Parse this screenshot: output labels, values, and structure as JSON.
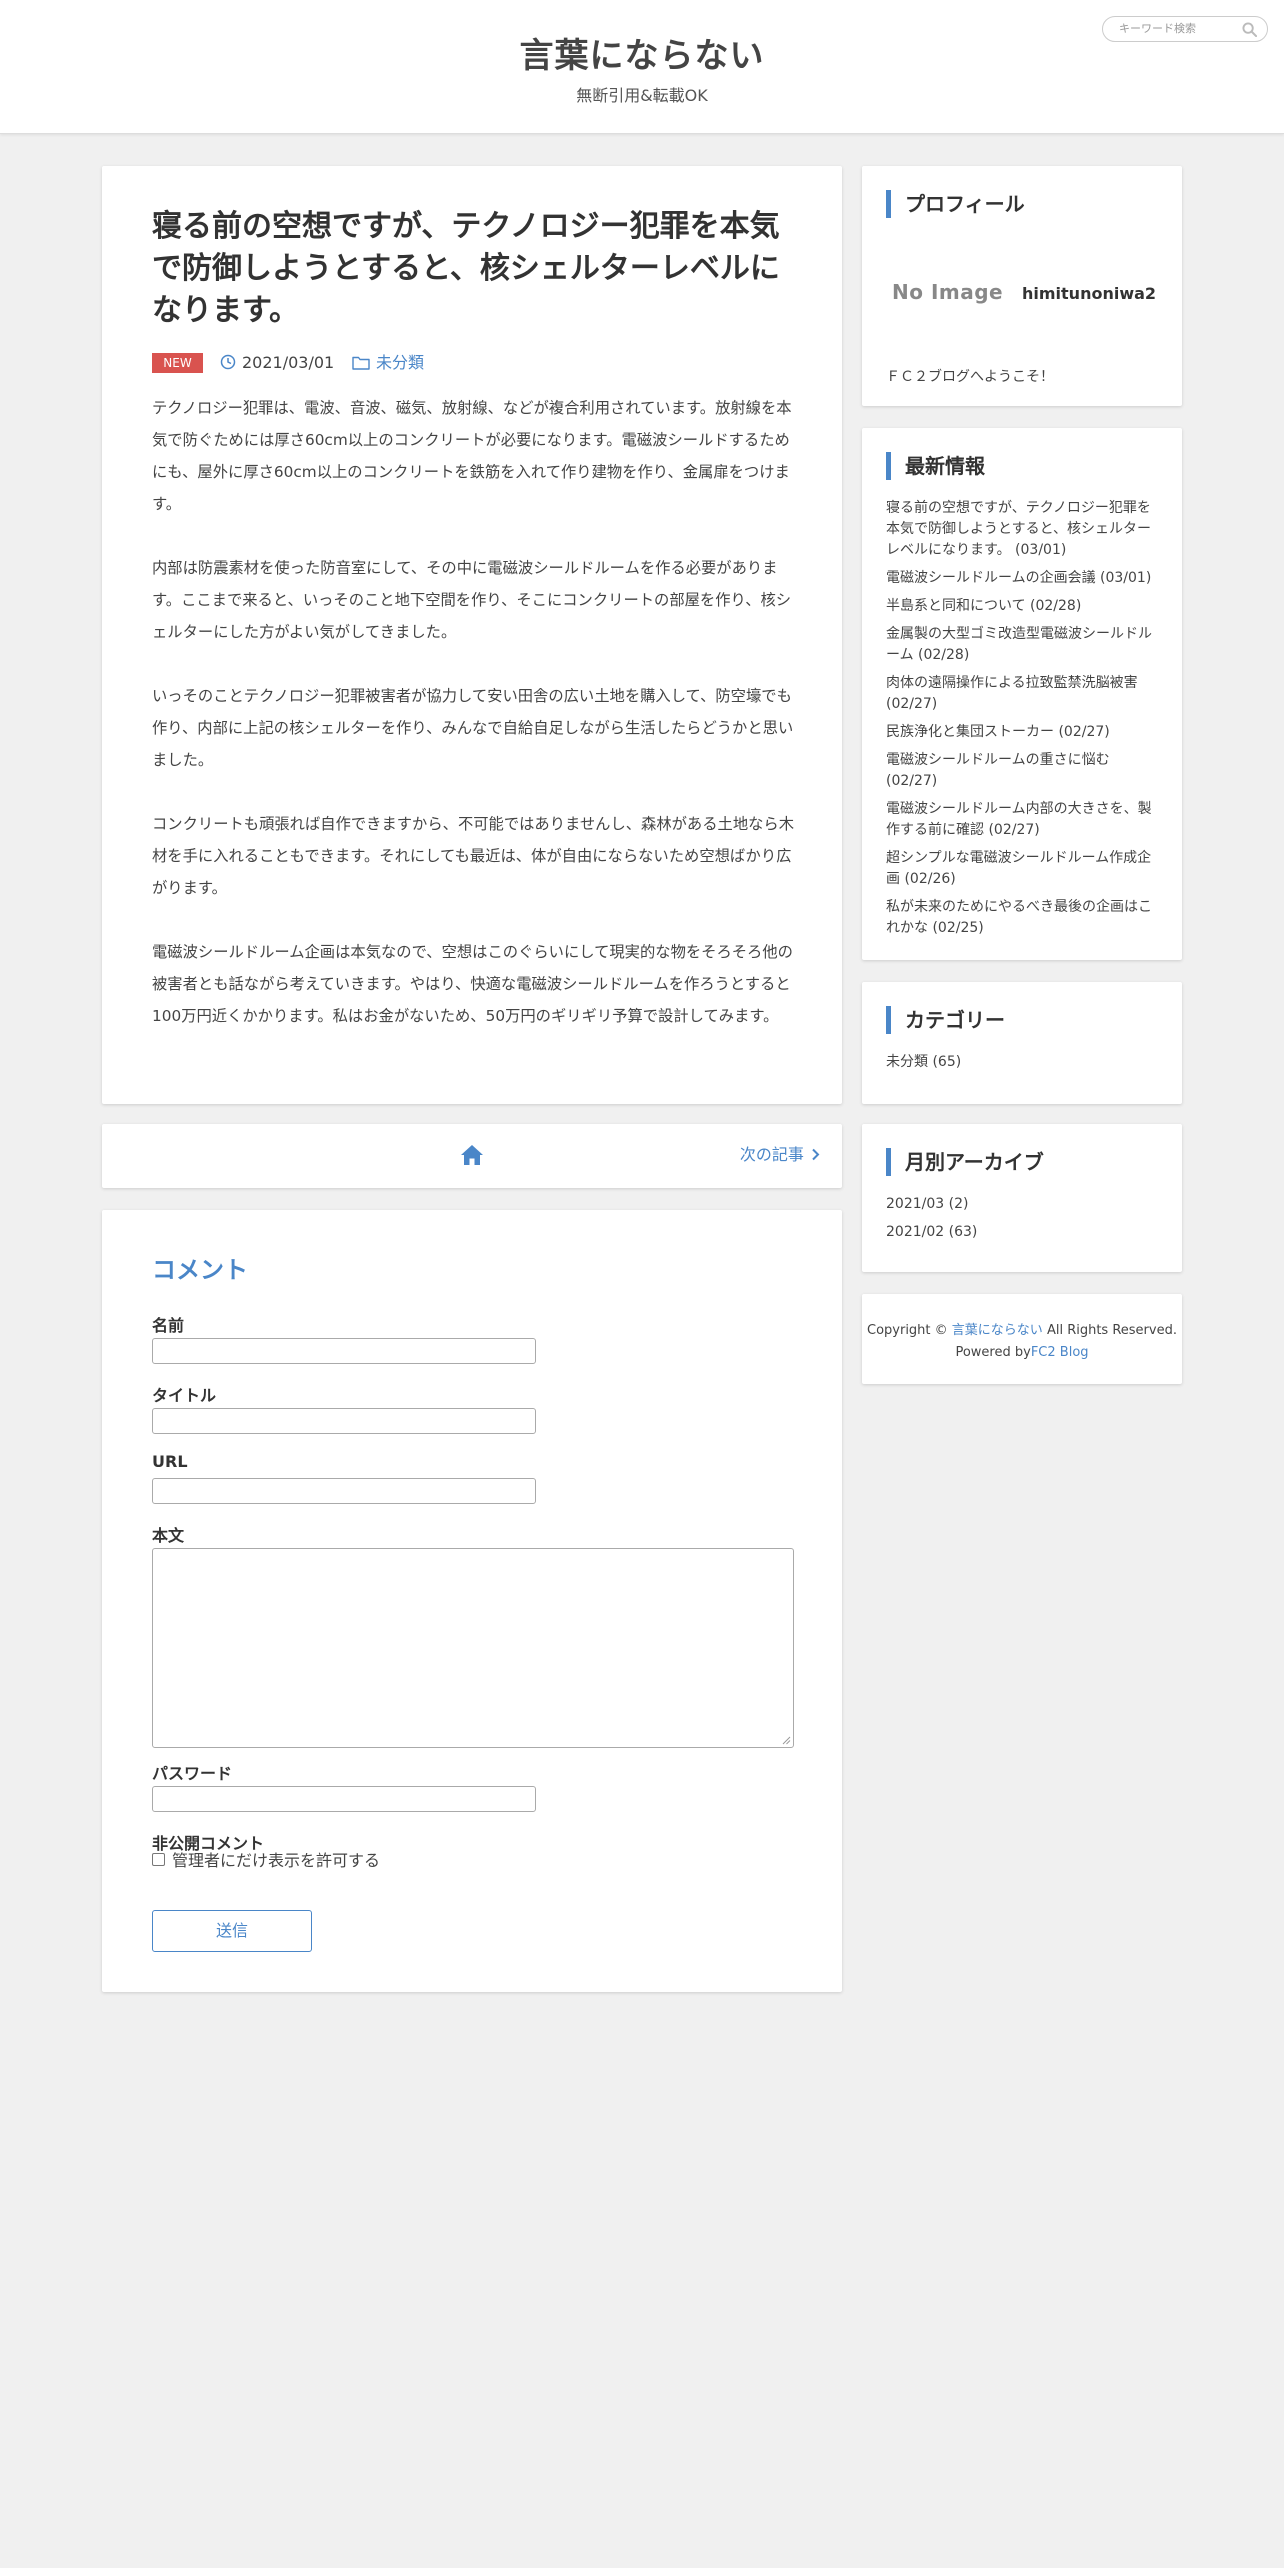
{
  "header": {
    "title": "言葉にならない",
    "subtitle": "無断引用&転載OK",
    "search_placeholder": "キーワード検索"
  },
  "article": {
    "title": "寝る前の空想ですが、テクノロジー犯罪を本気で防御しようとすると、核シェルターレベルになります。",
    "badge": "NEW",
    "date": "2021/03/01",
    "category": "未分類",
    "paragraphs": [
      "テクノロジー犯罪は、電波、音波、磁気、放射線、などが複合利用されています。放射線を本気で防ぐためには厚さ60cm以上のコンクリートが必要になります。電磁波シールドするためにも、屋外に厚さ60cm以上のコンクリートを鉄筋を入れて作り建物を作り、金属扉をつけます。",
      "内部は防震素材を使った防音室にして、その中に電磁波シールドルームを作る必要があります。ここまで来ると、いっそのこと地下空間を作り、そこにコンクリートの部屋を作り、核シェルターにした方がよい気がしてきました。",
      "いっそのことテクノロジー犯罪被害者が協力して安い田舎の広い土地を購入して、防空壕でも作り、内部に上記の核シェルターを作り、みんなで自給自足しながら生活したらどうかと思いました。",
      "コンクリートも頑張れば自作できますから、不可能ではありませんし、森林がある土地なら木材を手に入れることもできます。それにしても最近は、体が自由にならないため空想ばかり広がります。",
      "電磁波シールドルーム企画は本気なので、空想はこのぐらいにして現実的な物をそろそろ他の被害者とも話ながら考えていきます。やはり、快適な電磁波シールドルームを作ろうとすると100万円近くかかります。私はお金がないため、50万円のギリギリ予算で設計してみます。"
    ]
  },
  "pager": {
    "next_label": "次の記事"
  },
  "comment_form": {
    "heading": "コメント",
    "name_label": "名前",
    "title_label": "タイトル",
    "url_label": "URL",
    "body_label": "本文",
    "password_label": "パスワード",
    "private_label": "非公開コメント",
    "private_checkbox_label": "管理者にだけ表示を許可する",
    "submit_label": "送信"
  },
  "sidebar": {
    "profile": {
      "title": "プロフィール",
      "no_image": "No Image",
      "name": "himitunoniwa2",
      "welcome": "ＦＣ２ブログへようこそ！"
    },
    "recent": {
      "title": "最新情報",
      "items": [
        "寝る前の空想ですが、テクノロジー犯罪を本気で防御しようとすると、核シェルターレベルになります。 (03/01)",
        "電磁波シールドルームの企画会議 (03/01)",
        "半島系と同和について (02/28)",
        "金属製の大型ゴミ改造型電磁波シールドルーム (02/28)",
        "肉体の遠隔操作による拉致監禁洗脳被害 (02/27)",
        "民族浄化と集団ストーカー (02/27)",
        "電磁波シールドルームの重さに悩む (02/27)",
        "電磁波シールドルーム内部の大きさを、製作する前に確認 (02/27)",
        "超シンプルな電磁波シールドルーム作成企画 (02/26)",
        "私が未来のためにやるべき最後の企画はこれかな (02/25)"
      ]
    },
    "categories": {
      "title": "カテゴリー",
      "items": [
        "未分類 (65)"
      ]
    },
    "archive": {
      "title": "月別アーカイブ",
      "items": [
        "2021/03 (2)",
        "2021/02 (63)"
      ]
    },
    "footer": {
      "copyright_prefix": "Copyright ©",
      "site_link": "言葉にならない",
      "rights": "All Rights Reserved.",
      "powered_by": "Powered by",
      "fc2_link": "FC2 Blog"
    }
  },
  "colors": {
    "accent": "#4a86c8",
    "badge": "#d9534f",
    "background": "#f0f0f0"
  },
  "icons": [
    "search-icon",
    "clock-icon",
    "folder-icon",
    "home-icon",
    "chevron-right-icon"
  ]
}
